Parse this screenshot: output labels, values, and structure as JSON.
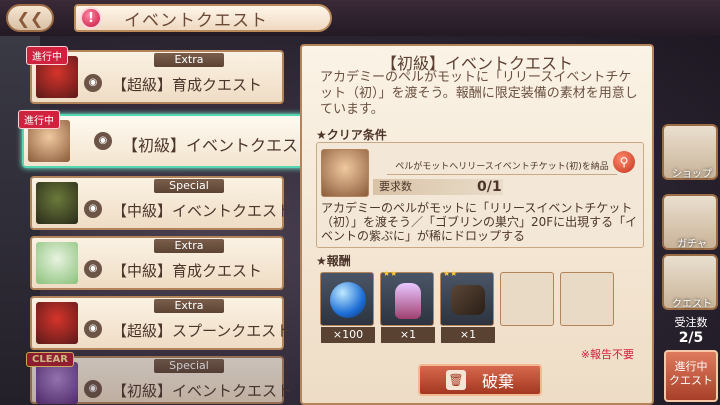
{
  "header": {
    "title": "イベントクエスト",
    "alert_icon": "exclamation-icon",
    "back_icon": "back-arrow-icon"
  },
  "quest_list": [
    {
      "tag": "進行中",
      "badge": "Extra",
      "title": "【超級】育成クエスト"
    },
    {
      "tag": "進行中",
      "badge": "",
      "title": "【初級】イベントクエスト"
    },
    {
      "tag": "",
      "badge": "Special",
      "title": "【中級】イベントクエスト"
    },
    {
      "tag": "",
      "badge": "Extra",
      "title": "【中級】育成クエスト"
    },
    {
      "tag": "",
      "badge": "Extra",
      "title": "【超級】スプーンクエスト"
    },
    {
      "tag": "CLEAR",
      "badge": "Special",
      "title": "【初級】イベントクエスト"
    }
  ],
  "detail": {
    "title": "【初級】イベントクエスト",
    "description": "アカデミーのペルがモットに「リリースイベントチケット（初）」を渡そう。報酬に限定装備の素材を用意しています。",
    "clear_condition_label": "クリア条件",
    "condition_text": "ペルがモットへリリースイベントチケット(初)を納品",
    "requirement_label": "要求数",
    "requirement_value": "0/1",
    "condition_description": "アカデミーのペルがモットに「リリースイベントチケット（初）」を渡そう／「ゴブリンの巣穴」20Fに出現する「イベントの紫ぷに」が稀にドロップする",
    "reward_label": "報酬",
    "rewards": [
      {
        "count": "×100"
      },
      {
        "count": "×1"
      },
      {
        "count": "×1"
      }
    ],
    "note": "※報告不要",
    "discard_label": "破棄"
  },
  "side": {
    "shop": "ショップ",
    "gacha": "ガチャ",
    "quest": "クエスト",
    "orders_label": "受注数",
    "orders_value": "2/5",
    "progress_button": "進行中\nクエスト"
  }
}
